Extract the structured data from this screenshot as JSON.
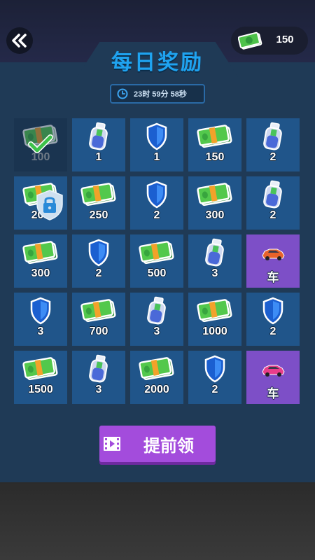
{
  "header": {
    "currency_amount": "150"
  },
  "panel": {
    "title": "每日奖励",
    "timer": "23时 59分 58秒"
  },
  "rewards": [
    {
      "type": "cash",
      "label": "100",
      "state": "claimed"
    },
    {
      "type": "potion",
      "label": "1",
      "state": "normal"
    },
    {
      "type": "shield",
      "label": "1",
      "state": "normal"
    },
    {
      "type": "cash",
      "label": "150",
      "state": "normal"
    },
    {
      "type": "potion",
      "label": "2",
      "state": "normal"
    },
    {
      "type": "cash",
      "label": "200",
      "state": "locked"
    },
    {
      "type": "cash",
      "label": "250",
      "state": "normal"
    },
    {
      "type": "shield",
      "label": "2",
      "state": "normal"
    },
    {
      "type": "cash",
      "label": "300",
      "state": "normal"
    },
    {
      "type": "potion",
      "label": "2",
      "state": "normal"
    },
    {
      "type": "cash",
      "label": "300",
      "state": "normal"
    },
    {
      "type": "shield",
      "label": "2",
      "state": "normal"
    },
    {
      "type": "cash",
      "label": "500",
      "state": "normal"
    },
    {
      "type": "potion",
      "label": "3",
      "state": "normal"
    },
    {
      "type": "car",
      "label": "车",
      "state": "normal",
      "color": "#e8632b"
    },
    {
      "type": "shield",
      "label": "3",
      "state": "normal"
    },
    {
      "type": "cash",
      "label": "700",
      "state": "normal"
    },
    {
      "type": "potion",
      "label": "3",
      "state": "normal"
    },
    {
      "type": "cash",
      "label": "1000",
      "state": "normal"
    },
    {
      "type": "shield",
      "label": "2",
      "state": "normal"
    },
    {
      "type": "cash",
      "label": "1500",
      "state": "normal"
    },
    {
      "type": "potion",
      "label": "3",
      "state": "normal"
    },
    {
      "type": "cash",
      "label": "2000",
      "state": "normal"
    },
    {
      "type": "shield",
      "label": "2",
      "state": "normal"
    },
    {
      "type": "car",
      "label": "车",
      "state": "normal",
      "color": "#e93d8a"
    }
  ],
  "claim_button": {
    "label": "提前领"
  },
  "colors": {
    "title": "#1fa3f0",
    "cell": "#20558a",
    "car_cell": "#7d4fc7",
    "button": "#a34cdc"
  }
}
